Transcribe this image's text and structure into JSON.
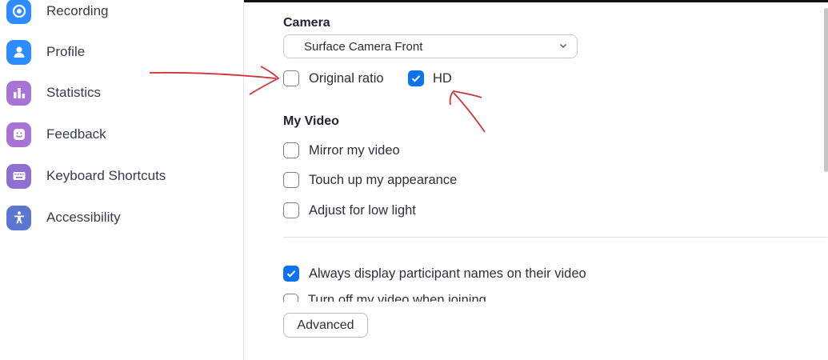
{
  "sidebar": {
    "items": [
      {
        "label": "Recording",
        "icon": "recording-icon",
        "color": "#2d8cff"
      },
      {
        "label": "Profile",
        "icon": "profile-icon",
        "color": "#2d8cff"
      },
      {
        "label": "Statistics",
        "icon": "statistics-icon",
        "color": "#a773d6"
      },
      {
        "label": "Feedback",
        "icon": "feedback-icon",
        "color": "#a773d6"
      },
      {
        "label": "Keyboard Shortcuts",
        "icon": "keyboard-icon",
        "color": "#8f6fd0"
      },
      {
        "label": "Accessibility",
        "icon": "accessibility-icon",
        "color": "#5a76cf"
      }
    ]
  },
  "camera": {
    "title": "Camera",
    "selected": "Surface Camera Front",
    "original_ratio": {
      "label": "Original ratio",
      "checked": false
    },
    "hd": {
      "label": "HD",
      "checked": true
    }
  },
  "my_video": {
    "title": "My Video",
    "options": [
      {
        "label": "Mirror my video",
        "checked": false
      },
      {
        "label": "Touch up my appearance",
        "checked": false
      },
      {
        "label": "Adjust for low light",
        "checked": false
      }
    ]
  },
  "display_names": {
    "label": "Always display participant names on their video",
    "checked": true
  },
  "clipped_option": {
    "label": "Turn off my video when joining meeting",
    "checked": false
  },
  "advanced_button": "Advanced",
  "colors": {
    "accent": "#0e72ed",
    "annotation": "#d0343a"
  }
}
